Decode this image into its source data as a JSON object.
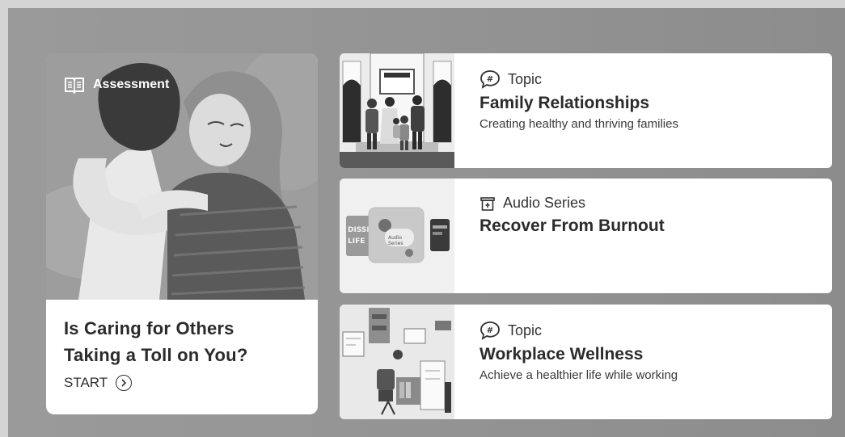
{
  "feature": {
    "badge_label": "Assessment",
    "badge_icon": "book-icon",
    "title_line1": "Is Caring for Others",
    "title_line2": "Taking a Toll on You?",
    "cta_label": "START",
    "cta_icon": "chevron-right-circle-icon"
  },
  "items": [
    {
      "type_icon": "hashtag-chat-icon",
      "type_label": "Topic",
      "title": "Family Relationships",
      "description": "Creating healthy and thriving families"
    },
    {
      "type_icon": "audio-series-icon",
      "type_label": "Audio Series",
      "title": "Recover From Burnout",
      "description": ""
    },
    {
      "type_icon": "hashtag-chat-icon",
      "type_label": "Topic",
      "title": "Workplace Wellness",
      "description": "Achieve a healthier life while working"
    }
  ]
}
